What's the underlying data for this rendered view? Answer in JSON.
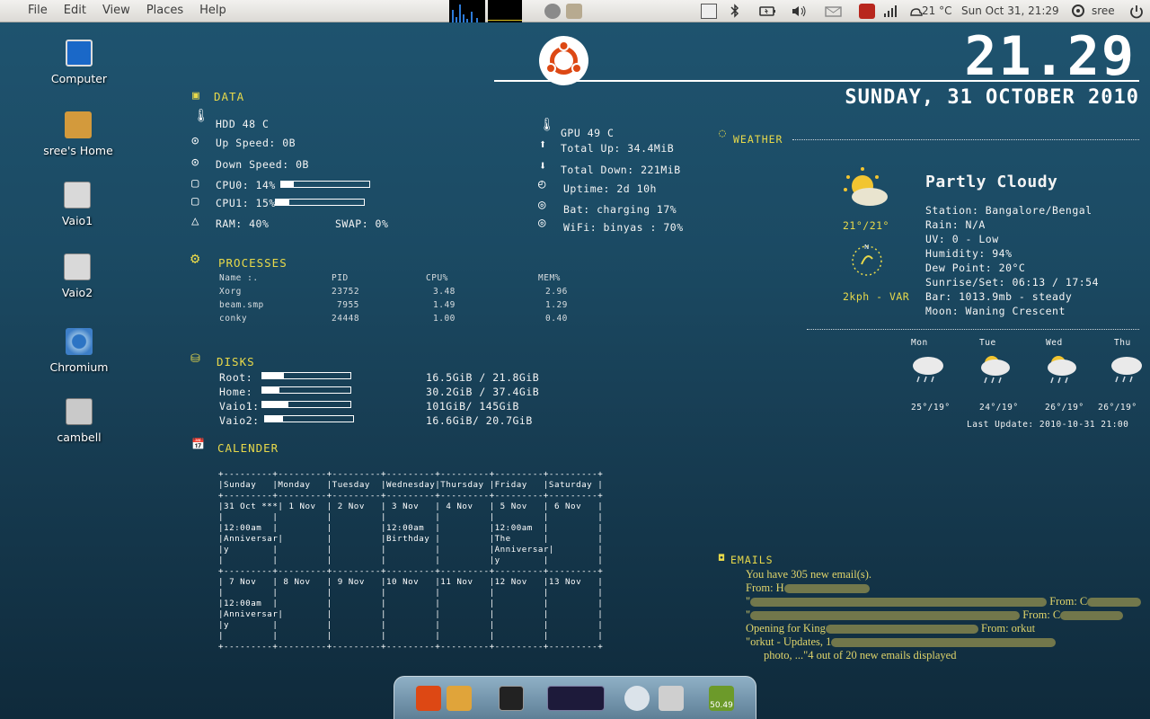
{
  "panel": {
    "menus": [
      "File",
      "Edit",
      "View",
      "Places",
      "Help"
    ],
    "temperature": "21 °C",
    "datetime": "Sun Oct 31, 21:29",
    "user": "sree"
  },
  "desktop_icons": [
    "Computer",
    "sree's Home",
    "Vaio1",
    "Vaio2",
    "Chromium",
    "cambell"
  ],
  "clock": {
    "time": "21.29",
    "date": "SUNDAY, 31 OCTOBER 2010"
  },
  "data": {
    "title": "DATA",
    "hdd": "HDD 48 C",
    "up_speed": "Up Speed: 0B",
    "down_speed": "Down Speed: 0B",
    "cpu0": "CPU0: 14%",
    "cpu0_pct": 14,
    "cpu1": "CPU1: 15%",
    "cpu1_pct": 15,
    "ram": "RAM: 40%",
    "swap": "SWAP: 0%",
    "gpu": "GPU 49 C",
    "total_up": "Total Up: 34.4MiB",
    "total_down": "Total Down: 221MiB",
    "uptime": "Uptime: 2d 10h",
    "bat": "Bat: charging 17%",
    "wifi": "WiFi: binyas : 70%"
  },
  "processes": {
    "title": "PROCESSES",
    "headers": [
      "Name :.",
      "PID",
      "CPU%",
      "MEM%"
    ],
    "rows": [
      [
        "Xorg",
        "23752",
        "3.48",
        "2.96"
      ],
      [
        "beam.smp",
        "7955",
        "1.49",
        "1.29"
      ],
      [
        "conky",
        "24448",
        "1.00",
        "0.40"
      ]
    ]
  },
  "disks": {
    "title": "DISKS",
    "items": [
      {
        "label": "Root:",
        "value": "16.5GiB / 21.8GiB",
        "fraction": 0.24
      },
      {
        "label": "Home:",
        "value": "30.2GiB / 37.4GiB",
        "fraction": 0.19
      },
      {
        "label": "Vaio1:",
        "value": "101GiB/ 145GiB",
        "fraction": 0.3
      },
      {
        "label": "Vaio2:",
        "value": "16.6GiB/ 20.7GiB",
        "fraction": 0.2
      }
    ]
  },
  "calendar": {
    "title": "CALENDER",
    "text": "+---------+---------+---------+---------+---------+---------+---------+\n|Sunday   |Monday   |Tuesday  |Wednesday|Thursday |Friday   |Saturday |\n+---------+---------+---------+---------+---------+---------+---------+\n|31 Oct ***| 1 Nov  | 2 Nov   | 3 Nov   | 4 Nov   | 5 Nov   | 6 Nov   |\n|         |         |         |         |         |         |         |\n|12:00am  |         |         |12:00am  |         |12:00am  |         |\n|Anniversar|        |         |Birthday |         |The      |         |\n|y        |         |         |         |         |Anniversar|        |\n|         |         |         |         |         |y        |         |\n+---------+---------+---------+---------+---------+---------+---------+\n| 7 Nov   | 8 Nov   | 9 Nov   |10 Nov   |11 Nov   |12 Nov   |13 Nov   |\n|         |         |         |         |         |         |         |\n|12:00am  |         |         |         |         |         |         |\n|Anniversar|        |         |         |         |         |         |\n|y        |         |         |         |         |         |         |\n|         |         |         |         |         |         |         |\n+---------+---------+---------+---------+---------+---------+---------+"
  },
  "weather": {
    "title": "WEATHER",
    "condition": "Partly Cloudy",
    "temp_range": "21°/21°",
    "wind": "2kph - VAR",
    "details": [
      "Station: Bangalore/Bengal",
      "Rain: N/A",
      "UV: 0 - Low",
      "Humidity: 94%",
      "Dew Point: 20°C",
      "Sunrise/Set: 06:13 / 17:54",
      "Bar: 1013.9mb - steady",
      "Moon: Waning Crescent"
    ],
    "forecast": [
      {
        "day": "Mon",
        "temps": "25°/19°"
      },
      {
        "day": "Tue",
        "temps": "24°/19°"
      },
      {
        "day": "Wed",
        "temps": "26°/19°"
      },
      {
        "day": "Thu",
        "temps": "26°/19°"
      }
    ],
    "last_update": "Last Update: 2010-10-31 21:00"
  },
  "emails": {
    "title": "EMAILS",
    "lines": [
      "You have 305 new email(s).",
      "From: H",
      "\"",
      "\"",
      "Opening for King",
      "\"orkut - Updates, 1",
      "photo, ...\"4 out of 20 new emails displayed"
    ],
    "from_tags": [
      "From: C",
      "From: C",
      "From: orkut"
    ]
  },
  "dock": {
    "badge": "50.49"
  },
  "colors": {
    "accent": "#e8d94a",
    "ubuntu": "#dd4814"
  }
}
